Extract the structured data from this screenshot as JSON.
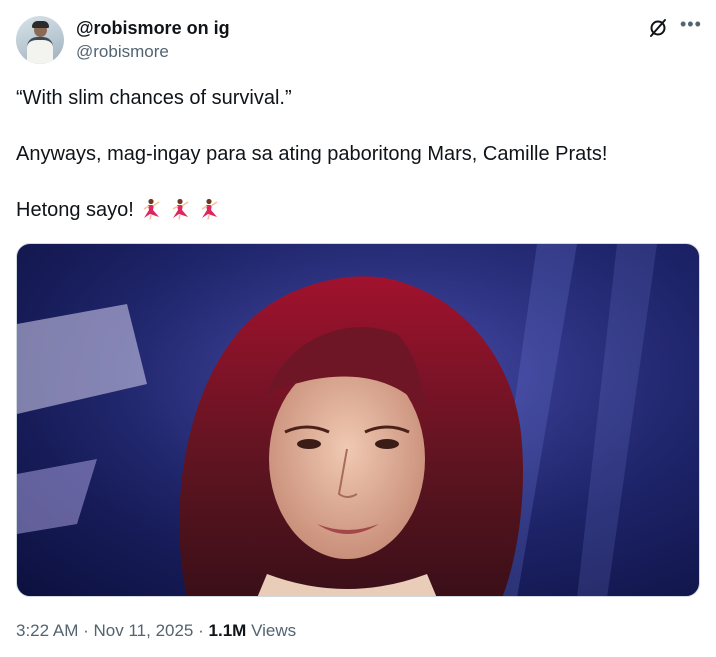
{
  "author": {
    "display_name": "@robismore on ig",
    "handle": "@robismore",
    "avatar_icon": "avatar-photo"
  },
  "tweet": {
    "lines": [
      "“With slim chances of survival.”",
      "Anyways, mag-ingay para sa ating paboritong Mars, Camille Prats!",
      "Hetong sayo!"
    ],
    "emoji": [
      "woman-dancing-icon",
      "woman-dancing-icon",
      "woman-dancing-icon"
    ]
  },
  "media": {
    "type": "video-still",
    "icon": "tweet-media-image"
  },
  "header_icons": {
    "grok": "grok-icon",
    "more": "more-options-icon"
  },
  "meta": {
    "time": "3:22 AM",
    "separator": "·",
    "date": "Nov 11, 2025",
    "views_count": "1.1M",
    "views_label": "Views"
  },
  "colors": {
    "primary_text": "#0f1419",
    "secondary_text": "#536471",
    "border": "#cfd9de",
    "dancer_dress": "#e0245e"
  }
}
